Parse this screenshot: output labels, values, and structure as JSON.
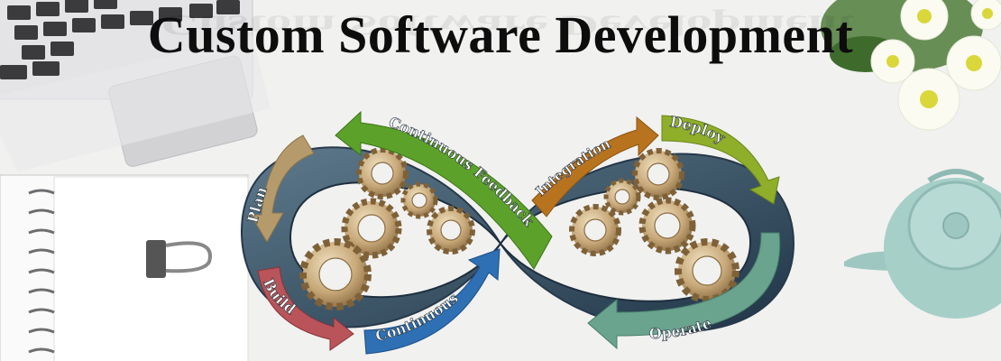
{
  "title": "Custom Software Development",
  "labels": {
    "feedback": "Continuous Feedback",
    "integration": "Integration",
    "deploy": "Deploy",
    "plan": "Plan",
    "build": "Build",
    "continuous": "Continuous",
    "operate": "Operate"
  },
  "colors": {
    "loop": "#2f4a5e",
    "feedback": "#5ca22a",
    "integration": "#b8731f",
    "deploy": "#8fae2a",
    "plan": "#b59a6c",
    "build": "#b9555a",
    "continuous": "#2f6fb3",
    "operate": "#6aa38e",
    "gear": "#c8a97a"
  },
  "icons": [
    "laptop-icon",
    "notebook-icon",
    "binder-clip-icon",
    "teapot-icon",
    "flower-icon",
    "gear-icon"
  ]
}
